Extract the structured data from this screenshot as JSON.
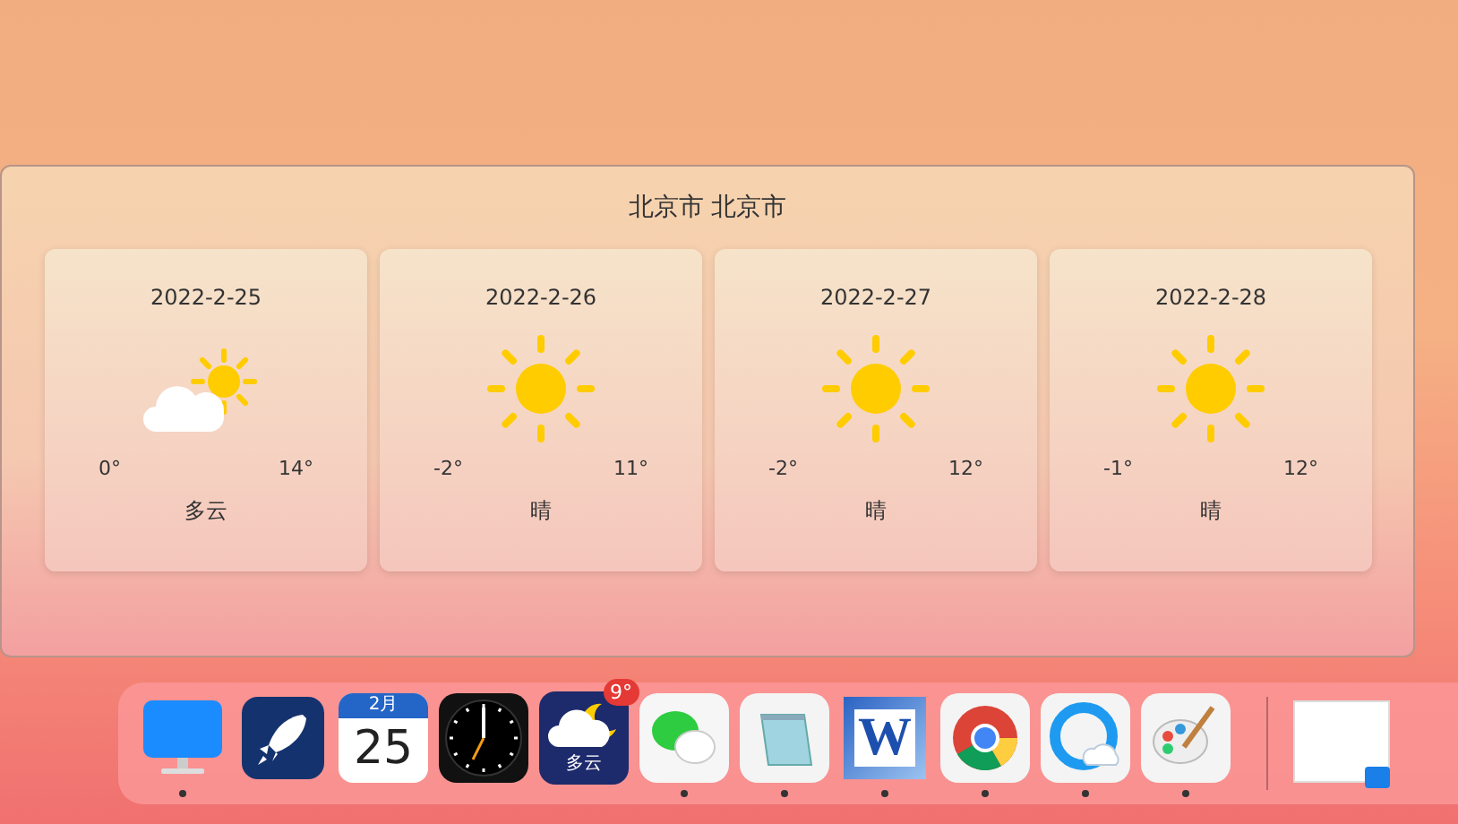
{
  "window": {
    "title": "北京市 北京市"
  },
  "days": [
    {
      "date": "2022-2-25",
      "kind": "cloudy",
      "low": "0°",
      "high": "14°",
      "condition": "多云"
    },
    {
      "date": "2022-2-26",
      "kind": "sunny",
      "low": "-2°",
      "high": "11°",
      "condition": "晴"
    },
    {
      "date": "2022-2-27",
      "kind": "sunny",
      "low": "-2°",
      "high": "12°",
      "condition": "晴"
    },
    {
      "date": "2022-2-28",
      "kind": "sunny",
      "low": "-1°",
      "high": "12°",
      "condition": "晴"
    }
  ],
  "dock": {
    "apps": [
      {
        "kind": "monitor",
        "running": true
      },
      {
        "kind": "rocket",
        "running": false
      },
      {
        "kind": "calendar",
        "running": false,
        "month": "2月",
        "day": "25"
      },
      {
        "kind": "clock",
        "running": false
      },
      {
        "kind": "weather",
        "running": false,
        "condition": "多云",
        "badge": "9°"
      },
      {
        "kind": "chat",
        "running": true
      },
      {
        "kind": "notepad",
        "running": true
      },
      {
        "kind": "word",
        "running": true,
        "letter": "W"
      },
      {
        "kind": "chrome",
        "running": true
      },
      {
        "kind": "browser",
        "running": true
      },
      {
        "kind": "paint",
        "running": true
      }
    ],
    "minimized": [
      {
        "kind": "window-thumbnail"
      }
    ]
  }
}
